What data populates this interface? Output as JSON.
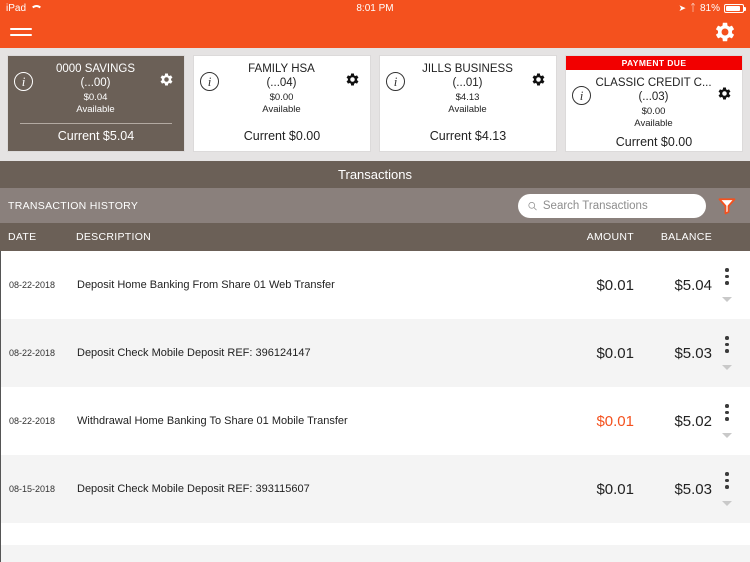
{
  "status_bar": {
    "carrier": "iPad",
    "wifi_icon": "wifi-icon",
    "time": "8:01 PM",
    "location_icon": "location-arrow-icon",
    "bluetooth_icon": "bluetooth-icon",
    "battery_percent": "81%",
    "battery_icon": "battery-icon"
  },
  "navbar": {
    "menu_icon": "hamburger-menu-icon",
    "settings_icon": "gear-icon",
    "accent_color": "#f4511e"
  },
  "accounts": [
    {
      "name": "0000 SAVINGS",
      "mask": "(...00)",
      "available_amount": "$0.04",
      "available_label": "Available",
      "current": "Current $5.04",
      "badge": "",
      "selected": true,
      "info_icon": "info-icon",
      "gear_icon": "gear-icon"
    },
    {
      "name": "FAMILY HSA",
      "mask": "(...04)",
      "available_amount": "$0.00",
      "available_label": "Available",
      "current": "Current $0.00",
      "badge": "",
      "selected": false,
      "info_icon": "info-icon",
      "gear_icon": "gear-icon"
    },
    {
      "name": "JILLS BUSINESS",
      "mask": "(...01)",
      "available_amount": "$4.13",
      "available_label": "Available",
      "current": "Current $4.13",
      "badge": "",
      "selected": false,
      "info_icon": "info-icon",
      "gear_icon": "gear-icon"
    },
    {
      "name": "CLASSIC CREDIT C...",
      "mask": "(...03)",
      "available_amount": "$0.00",
      "available_label": "Available",
      "current": "Current $0.00",
      "badge": "PAYMENT DUE",
      "badge_color": "#f20000",
      "selected": false,
      "info_icon": "info-icon",
      "gear_icon": "gear-icon"
    }
  ],
  "transactions_panel": {
    "title": "Transactions",
    "history_label": "TRANSACTION HISTORY",
    "search": {
      "placeholder": "Search Transactions",
      "value": "",
      "icon": "search-icon"
    },
    "filter_icon": "funnel-filter-icon",
    "filter_color": "#f4511e",
    "columns": {
      "date": "DATE",
      "description": "DESCRIPTION",
      "amount": "AMOUNT",
      "balance": "BALANCE"
    },
    "rows": [
      {
        "date": "08-22-2018",
        "description": "Deposit Home Banking From Share 01 Web Transfer",
        "amount": "$0.01",
        "balance": "$5.04",
        "is_debit": false,
        "menu_icon": "more-vertical-icon",
        "expand_icon": "chevron-down-icon"
      },
      {
        "date": "08-22-2018",
        "description": "Deposit Check Mobile Deposit REF: 396124147",
        "amount": "$0.01",
        "balance": "$5.03",
        "is_debit": false,
        "menu_icon": "more-vertical-icon",
        "expand_icon": "chevron-down-icon"
      },
      {
        "date": "08-22-2018",
        "description": "Withdrawal Home Banking To Share 01 Mobile Transfer",
        "amount": "$0.01",
        "balance": "$5.02",
        "is_debit": true,
        "menu_icon": "more-vertical-icon",
        "expand_icon": "chevron-down-icon"
      },
      {
        "date": "08-15-2018",
        "description": "Deposit Check Mobile Deposit REF: 393115607",
        "amount": "$0.01",
        "balance": "$5.03",
        "is_debit": false,
        "menu_icon": "more-vertical-icon",
        "expand_icon": "chevron-down-icon"
      }
    ]
  }
}
